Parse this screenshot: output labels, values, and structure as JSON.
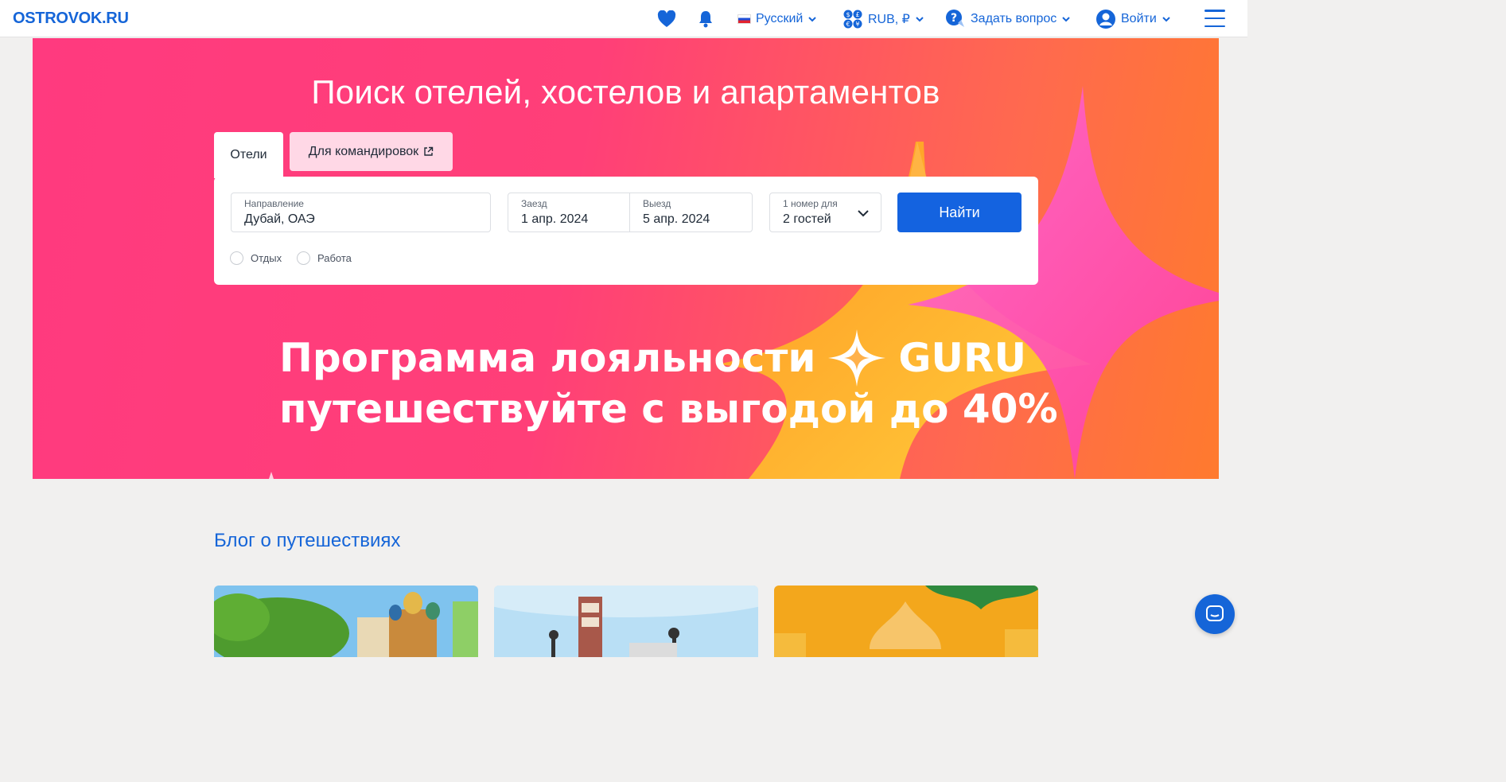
{
  "header": {
    "logo": "OSTROVOK.RU",
    "language": "Русский",
    "currency": "RUB, ₽",
    "ask_question": "Задать вопрос",
    "login": "Войти"
  },
  "hero": {
    "title": "Поиск отелей, хостелов и апартаментов",
    "tabs": [
      {
        "label": "Отели"
      },
      {
        "label": "Для командировок"
      }
    ],
    "search": {
      "destination": {
        "label": "Направление",
        "value": "Дубай, ОАЭ"
      },
      "checkin": {
        "label": "Заезд",
        "value": "1 апр. 2024"
      },
      "checkout": {
        "label": "Выезд",
        "value": "5 апр. 2024"
      },
      "guests": {
        "label": "1 номер для",
        "value": "2 гостей"
      },
      "submit": "Найти",
      "trip_types": [
        "Отдых",
        "Работа"
      ]
    },
    "promo": {
      "line1": "Программа лояльности",
      "brand": "GURU",
      "line2": "путешествуйте с выгодой до 40%"
    }
  },
  "blog": {
    "title": "Блог о путешествиях"
  },
  "colors": {
    "brand_blue": "#1565d8",
    "hero_pink": "#ff3a7f",
    "hero_orange": "#ff7a2e"
  }
}
